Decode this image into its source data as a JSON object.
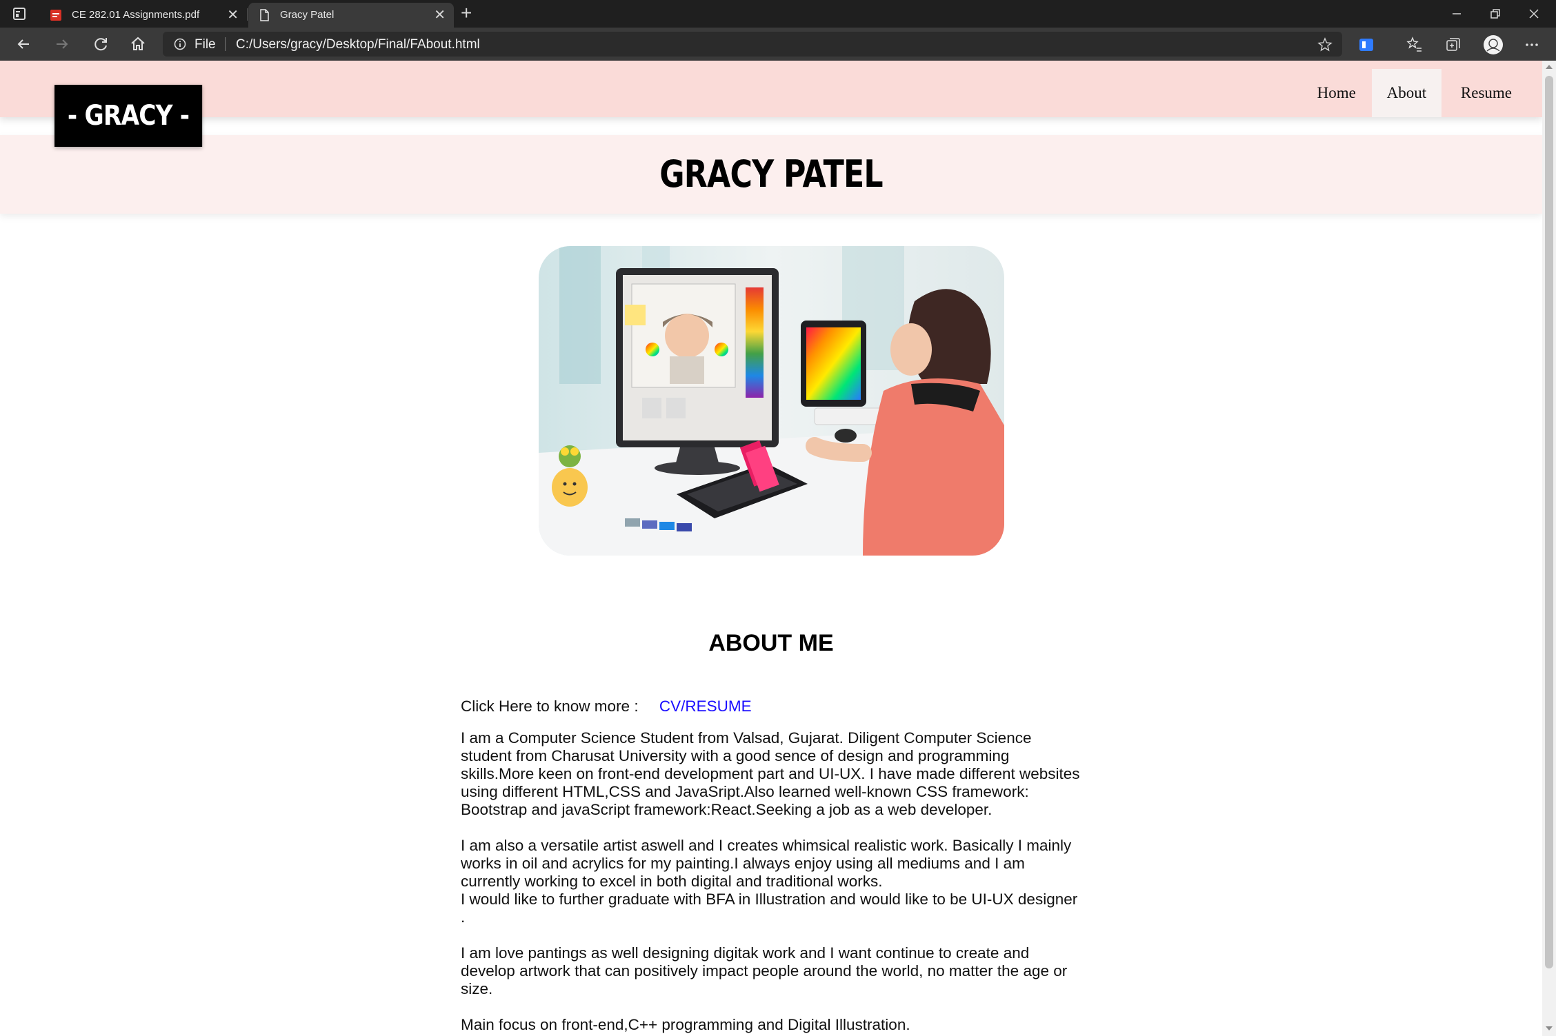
{
  "browser": {
    "tabs": [
      {
        "title": "CE 282.01 Assignments.pdf",
        "icon": "pdf-icon",
        "active": false
      },
      {
        "title": "Gracy Patel",
        "icon": "page-icon",
        "active": true
      }
    ],
    "address": {
      "scheme_label": "File",
      "url": "C:/Users/gracy/Desktop/Final/FAbout.html"
    },
    "close_glyph": "✕",
    "new_tab_glyph": "+"
  },
  "site": {
    "brand": "- GRACY -",
    "nav": [
      {
        "label": "Home",
        "active": false
      },
      {
        "label": "About",
        "active": true
      },
      {
        "label": "Resume",
        "active": false
      }
    ],
    "hero_title": "GRACY PATEL",
    "about": {
      "heading": "ABOUT ME",
      "more_label": "Click Here to know more :",
      "cv_link": "CV/RESUME",
      "para1": "I am a Computer Science Student from Valsad, Gujarat. Diligent Computer Science student from Charusat University with a good sence of design and programming skills.More keen on front-end development part and UI-UX. I have made different websites using different HTML,CSS and JavaSript.Also learned well-known CSS framework: Bootstrap and javaScript framework:React.Seeking a job as a web developer.",
      "para2a": "I am also a versatile artist aswell and I creates whimsical realistic work. Basically I mainly works in oil and acrylics for my painting.I always enjoy using all mediums and I am currently working to excel in both digital and traditional works.",
      "para2b": "I would like to further graduate with BFA in Illustration and would like to be UI-UX designer .",
      "para3": "I am love pantings as well designing digitak work and I want continue to create and develop artwork that can positively impact people around the world, no matter the age or size.",
      "para4": "Main focus on front-end,C++ programming and Digital Illustration."
    }
  },
  "colors": {
    "navbar": "#fadbd8",
    "hero_band": "#fcefee",
    "link": "#1a0dff",
    "brand_bg": "#000000"
  }
}
